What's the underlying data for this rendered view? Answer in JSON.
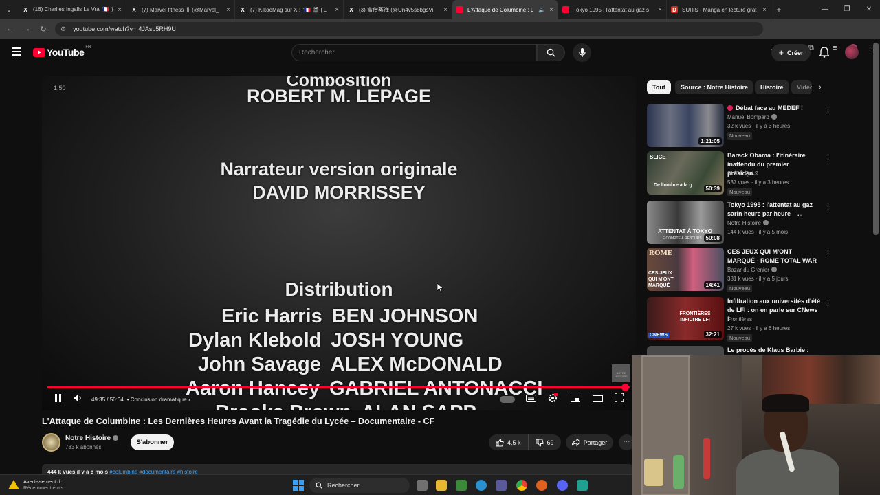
{
  "browser": {
    "tabs": [
      {
        "title": "(16) Charlies Ingalls Le Vrai 🇫🇷 🇫",
        "icon": "x-icon",
        "active": false
      },
      {
        "title": "(7) Marvel fitness ㅒ (@Marvel_",
        "icon": "x-icon",
        "active": false
      },
      {
        "title": "(7) KikooMag sur X : \"🇫🇷 🎬 | L",
        "icon": "x-icon",
        "active": false
      },
      {
        "title": "(3) 富僧蒸禅 (@Un4v5s8bgsVi",
        "icon": "x-icon",
        "active": false
      },
      {
        "title": "L'Attaque de Columbine : L",
        "icon": "youtube-icon",
        "active": true
      },
      {
        "title": "Tokyo 1995 : l'attentat au gaz s",
        "icon": "youtube-icon",
        "active": false
      },
      {
        "title": "SUITS - Manga en lecture grat",
        "icon": "document-icon",
        "active": false
      }
    ],
    "url": "youtube.com/watch?v=r4JAsb5RH9U"
  },
  "youtube": {
    "logo_text": "YouTube",
    "country_code": "FR",
    "search_placeholder": "Rechercher",
    "create_label": "Créer"
  },
  "video": {
    "overlay_timecode": "1.50",
    "credits": {
      "composition_label": "Composition",
      "composer": "ROBERT M. LEPAGE",
      "narrator_label": "Narrateur version originale",
      "narrator": "DAVID MORRISSEY",
      "distribution_label": "Distribution",
      "cast": [
        {
          "role": "Eric Harris",
          "actor": "BEN JOHNSON"
        },
        {
          "role": "Dylan Klebold",
          "actor": "JOSH YOUNG"
        },
        {
          "role": "John Savage",
          "actor": "ALEX McDONALD"
        },
        {
          "role": "Aaron Hancey",
          "actor": "GABRIEL ANTONACCI"
        },
        {
          "role": "Brooks Brown",
          "actor": "ALAN SAPP"
        }
      ]
    },
    "watermark_text": "NOTRE HISTOIRE",
    "current_time": "49:35",
    "duration": "50:04",
    "time_display": "49:35 / 50:04",
    "chapter": "Conclusion dramatique",
    "progress": 0.99,
    "title": "L'Attaque de Columbine : Les Dernières Heures Avant la Tragédie du Lycée – Documentaire - CF",
    "channel": "Notre Histoire",
    "subscribers": "783 k abonnés",
    "subscribe_label": "S'abonner",
    "likes": "4,5 k",
    "dislikes": "69",
    "share_label": "Partager",
    "description_meta": "444 k vues  il y a 8 mois",
    "description_tags": "#columbine #documentaire #histoire"
  },
  "chips": [
    "Tout",
    "Source : Notre Histoire",
    "Histoire",
    "Vidéos"
  ],
  "recommendations": [
    {
      "title": "Débat face au MEDEF !",
      "live_dot": true,
      "channel": "Manuel Bompard",
      "verified": true,
      "meta": "32 k vues · il y a 3 heures",
      "badge": "Nouveau",
      "duration": "1:21:05",
      "thumb_color": "#3a4460"
    },
    {
      "title": "Barack Obama : l'itinéraire inattendu du premier présiden...",
      "live_dot": false,
      "channel": "SLICE Qui ?",
      "verified": false,
      "meta": "537 vues · il y a 3 heures",
      "badge": "Nouveau",
      "duration": "50:39",
      "thumb_color": "#3a4a36",
      "thumb_text": "SLICE",
      "thumb_sub": "De l'ombre à la g"
    },
    {
      "title": "Tokyo 1995 : l'attentat au gaz sarin heure par heure – ...",
      "live_dot": false,
      "channel": "Notre Histoire",
      "verified": true,
      "meta": "144 k vues · il y a 5 mois",
      "badge": "",
      "duration": "50:08",
      "thumb_color": "#5a5a5a",
      "thumb_text": "ATTENTAT À TOKYO",
      "thumb_sub": "LE COMPTE À REBOURS"
    },
    {
      "title": "CES JEUX QUI M'ONT MARQUÉ - ROME TOTAL WAR",
      "live_dot": false,
      "channel": "Bazar du Grenier",
      "verified": true,
      "meta": "381 k vues · il y a 5 jours",
      "badge": "Nouveau",
      "duration": "14:41",
      "thumb_color": "#5a3a4a",
      "thumb_text": "ROME",
      "thumb_sub": "CES JEUX QUI M'ONT MARQUÉ"
    },
    {
      "title": "Infiltration aux universités d'été de LFI : on en parle sur CNews !",
      "live_dot": false,
      "channel": "Frontières",
      "verified": false,
      "meta": "27 k vues · il y a 6 heures",
      "badge": "Nouveau",
      "duration": "32:21",
      "thumb_color": "#6a1a1a",
      "thumb_text": "FRONTIÈRES INFILTRE LFI",
      "thumb_sub": "CNEWS"
    },
    {
      "title": "Le procès de Klaus Barbie :",
      "live_dot": false,
      "channel": "",
      "verified": false,
      "meta": "",
      "badge": "",
      "duration": "",
      "thumb_color": "#4a4a4a"
    }
  ],
  "taskbar": {
    "notification_title": "Avertissement d...",
    "notification_sub": "Récemment émis",
    "search_label": "Rechercher"
  },
  "colors": {
    "accent_red": "#ff0033",
    "background": "#0f0f0f",
    "chip_bg": "#272727"
  }
}
